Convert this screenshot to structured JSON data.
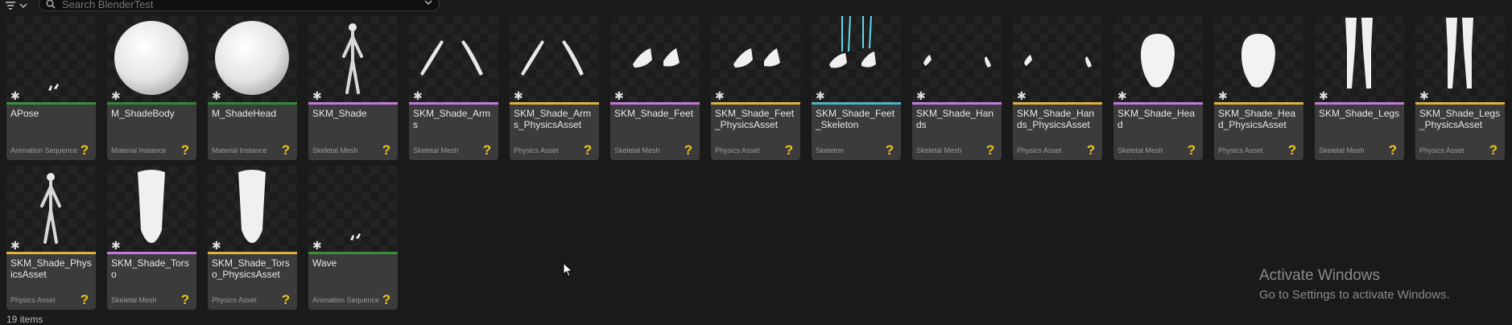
{
  "toolbar": {
    "search_placeholder": "Search BlenderTest"
  },
  "colors": {
    "animation": "#3a8f3a",
    "material": "#2e8b2e",
    "skeletal_mesh": "#c678dd",
    "physics": "#e0b040",
    "skeleton": "#4fb3c9"
  },
  "assets": [
    {
      "name": "APose",
      "type": "Animation Sequence",
      "kind": "animation",
      "icon": "tiny-hands-icon"
    },
    {
      "name": "M_ShadeBody",
      "type": "Material Instance",
      "kind": "material",
      "icon": "sphere-icon"
    },
    {
      "name": "M_ShadeHead",
      "type": "Material Instance",
      "kind": "material",
      "icon": "sphere-icon"
    },
    {
      "name": "SKM_Shade",
      "type": "Skeletal Mesh",
      "kind": "skeletal_mesh",
      "icon": "figure-icon"
    },
    {
      "name": "SKM_Shade_Arms",
      "type": "Skeletal Mesh",
      "kind": "skeletal_mesh",
      "icon": "arms-icon"
    },
    {
      "name": "SKM_Shade_Arms_PhysicsAsset",
      "type": "Physics Asset",
      "kind": "physics",
      "icon": "arms-icon"
    },
    {
      "name": "SKM_Shade_Feet",
      "type": "Skeletal Mesh",
      "kind": "skeletal_mesh",
      "icon": "feet-icon"
    },
    {
      "name": "SKM_Shade_Feet_PhysicsAsset",
      "type": "Physics Asset",
      "kind": "physics",
      "icon": "feet-icon"
    },
    {
      "name": "SKM_Shade_Feet_Skeleton",
      "type": "Skeleton",
      "kind": "skeleton",
      "icon": "skeleton-feet-icon"
    },
    {
      "name": "SKM_Shade_Hands",
      "type": "Skeletal Mesh",
      "kind": "skeletal_mesh",
      "icon": "hands-icon"
    },
    {
      "name": "SKM_Shade_Hands_PhysicsAsset",
      "type": "Physics Asset",
      "kind": "physics",
      "icon": "hands-icon"
    },
    {
      "name": "SKM_Shade_Head",
      "type": "Skeletal Mesh",
      "kind": "skeletal_mesh",
      "icon": "head-icon"
    },
    {
      "name": "SKM_Shade_Head_PhysicsAsset",
      "type": "Physics Asset",
      "kind": "physics",
      "icon": "head-icon"
    },
    {
      "name": "SKM_Shade_Legs",
      "type": "Skeletal Mesh",
      "kind": "skeletal_mesh",
      "icon": "legs-icon"
    },
    {
      "name": "SKM_Shade_Legs_PhysicsAsset",
      "type": "Physics Asset",
      "kind": "physics",
      "icon": "legs-icon"
    },
    {
      "name": "SKM_Shade_PhysicsAsset",
      "type": "Physics Asset",
      "kind": "physics",
      "icon": "figure-icon"
    },
    {
      "name": "SKM_Shade_Torso",
      "type": "Skeletal Mesh",
      "kind": "skeletal_mesh",
      "icon": "torso-icon"
    },
    {
      "name": "SKM_Shade_Torso_PhysicsAsset",
      "type": "Physics Asset",
      "kind": "physics",
      "icon": "torso-icon"
    },
    {
      "name": "Wave",
      "type": "Animation Sequence",
      "kind": "animation",
      "icon": "tiny-hands-icon"
    }
  ],
  "status": {
    "item_count": "19 items"
  },
  "watermark": {
    "title": "Activate Windows",
    "subtitle": "Go to Settings to activate Windows."
  }
}
